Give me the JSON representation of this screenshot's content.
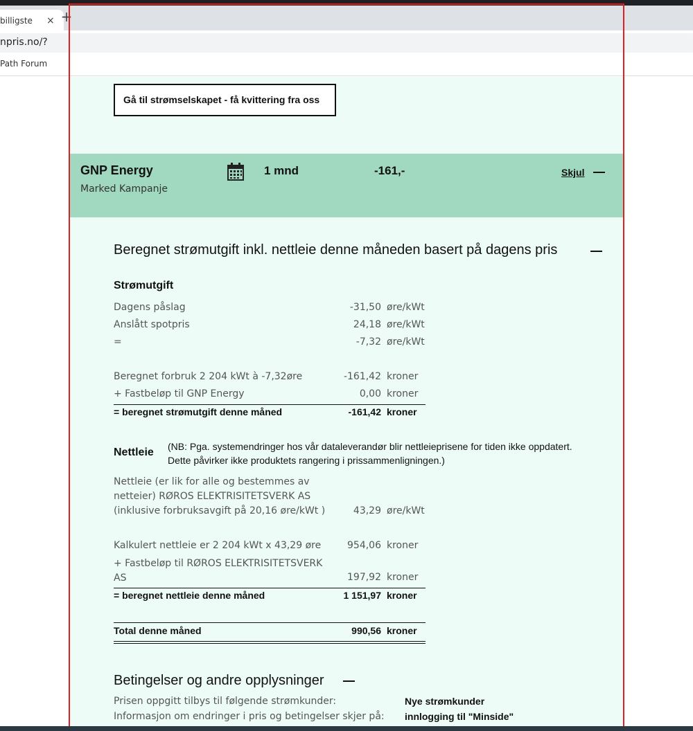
{
  "browser": {
    "tab_title": "billigste",
    "tab_close": "×",
    "new_tab": "+",
    "url": "npris.no/?",
    "bookmark": "Path Forum"
  },
  "page": {
    "receipt_button": "Gå til strømselskapet - få kvittering fra oss",
    "provider": {
      "name": "GNP Energy",
      "product": "Marked Kampanje",
      "icon": "calendar-icon",
      "period": "1 mnd",
      "price": "-161,-",
      "hide_label": "Skjul"
    },
    "estimate_heading": "Beregnet strømutgift inkl. nettleie denne måneden basert på dagens pris",
    "power": {
      "heading": "Strømutgift",
      "rows": [
        {
          "label": "Dagens påslag",
          "value": "-31,50",
          "unit": "øre/kWt"
        },
        {
          "label": "Anslått spotpris",
          "value": "24,18",
          "unit": "øre/kWt"
        },
        {
          "label": "=",
          "value": "-7,32",
          "unit": "øre/kWt"
        },
        {
          "label": "Beregnet forbruk 2 204 kWt à -7,32øre",
          "value": "-161,42",
          "unit": "kroner"
        },
        {
          "label": "+ Fastbeløp til GNP Energy",
          "value": "0,00",
          "unit": "kroner"
        }
      ],
      "total": {
        "label": "= beregnet strømutgift denne måned",
        "value": "-161,42",
        "unit": "kroner"
      }
    },
    "grid": {
      "heading": "Nettleie",
      "note": "(NB: Pga. systemendringer hos vår dataleverandør blir nettleieprisene for tiden ikke oppdatert. Dette påvirker ikke produktets rangering i prissammenligningen.)",
      "desc_line1": "Nettleie (er lik for alle og bestemmes av",
      "desc_line2": "netteier) RØROS ELEKTRISITETSVERK AS",
      "desc_line3": "(inklusive forbruksavgift på 20,16 øre/kWt )",
      "desc_value": "43,29",
      "desc_unit": "øre/kWt",
      "calc": {
        "label": "Kalkulert nettleie er 2 204 kWt x 43,29 øre",
        "value": "954,06",
        "unit": "kroner"
      },
      "fixed_line1": "+ Fastbeløp til RØROS ELEKTRISITETSVERK",
      "fixed_line2": "AS",
      "fixed_value": "197,92",
      "fixed_unit": "kroner",
      "total": {
        "label": "= beregnet nettleie denne måned",
        "value": "1 151,97",
        "unit": "kroner"
      }
    },
    "grand_total": {
      "label": "Total denne måned",
      "value": "990,56",
      "unit": "kroner"
    },
    "terms": {
      "heading": "Betingelser og andre opplysninger",
      "rows": [
        {
          "label": "Prisen oppgitt tilbys til følgende strømkunder:",
          "value": "Nye strømkunder"
        },
        {
          "label": "Informasjon om endringer i pris og betingelser skjer på:",
          "value": "innlogging til \"Minside\""
        }
      ]
    }
  }
}
